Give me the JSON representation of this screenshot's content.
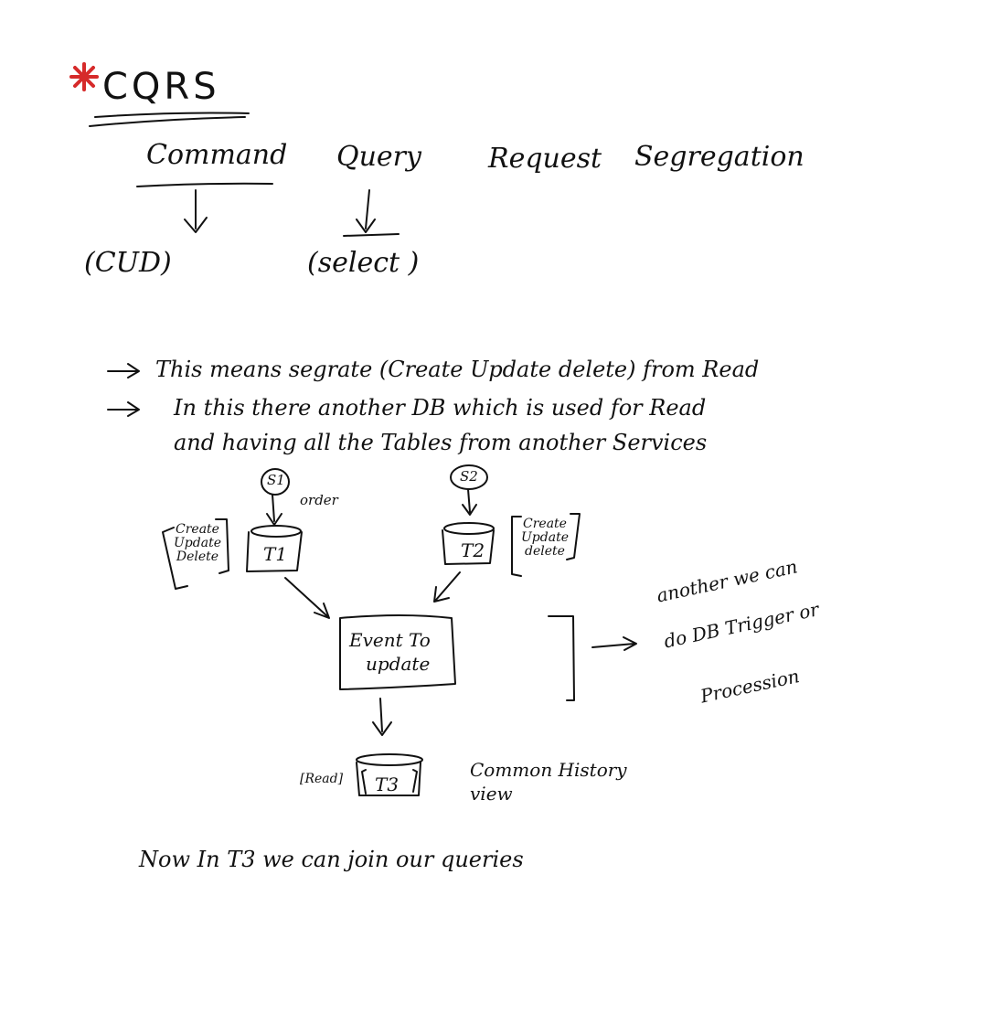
{
  "title": "CQRS",
  "expansion": {
    "command": "Command",
    "query": "Query",
    "request": "Request",
    "segregation": "Segregation"
  },
  "command_note": "(CUD)",
  "query_note": "(select )",
  "bullets": [
    "This means segrate (Create Update delete) from Read",
    "In this there another DB which is used for Read",
    "and having all the Tables from another Services"
  ],
  "diagram": {
    "service1": "S1",
    "service2": "S2",
    "order_label": "order",
    "table1": "T1",
    "table2": "T2",
    "table3": "T3",
    "ops1": [
      "Create",
      "Update",
      "Delete"
    ],
    "ops2": [
      "Create",
      "Update",
      "delete"
    ],
    "event_box_line1": "Event To",
    "event_box_line2": "update",
    "alt_line1": "another we can",
    "alt_line2": "do DB Trigger or",
    "alt_line3": "Procession",
    "read_tag": "[Read]",
    "common_line1": "Common History",
    "common_line2": "view"
  },
  "footer": "Now In T3 we can join our queries",
  "colors": {
    "star": "#d62a2a",
    "ink": "#111111"
  }
}
